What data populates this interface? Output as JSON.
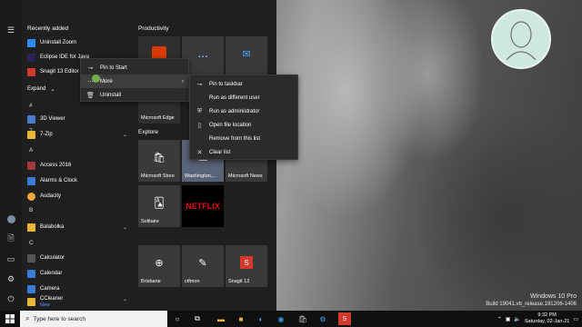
{
  "desktop": {
    "watermark_line1": "Windows 10 Pro",
    "watermark_line2": "Build 19041.vb_release.191206-1406"
  },
  "start": {
    "recently_added_label": "Recently added",
    "recent": [
      {
        "label": "Uninstall Zoom",
        "icon": "zoom-icon",
        "color": "#2d8cff"
      },
      {
        "label": "Eclipse IDE for Java",
        "icon": "eclipse-icon",
        "color": "#2c2255"
      },
      {
        "label": "Snagit 13 Editor",
        "icon": "snagit-icon",
        "color": "#d0392b"
      }
    ],
    "expand_label": "Expand",
    "sections": [
      {
        "letter": "#",
        "items": [
          {
            "label": "3D Viewer",
            "color": "#4a7cc9"
          }
        ]
      },
      {
        "letter": "7",
        "items": [
          {
            "label": "7-Zip",
            "color": "#e8b73a"
          }
        ]
      },
      {
        "letter": "A",
        "items": [
          {
            "label": "Access 2016",
            "color": "#a4373a"
          },
          {
            "label": "Alarms & Clock",
            "color": "#3a7bd5"
          },
          {
            "label": "Audacity",
            "color": "#f2a33c"
          }
        ]
      },
      {
        "letter": "B",
        "items": [
          {
            "label": "Balabolka",
            "color": "#e8b73a"
          }
        ]
      },
      {
        "letter": "C",
        "items": [
          {
            "label": "Calculator",
            "color": "#555555"
          },
          {
            "label": "Calendar",
            "color": "#3a7bd5"
          },
          {
            "label": "Camera",
            "color": "#3a7bd5"
          },
          {
            "label": "CCleaner",
            "color": "#e8b73a"
          }
        ]
      }
    ],
    "new_badge": "New",
    "productivity_label": "Productivity",
    "explore_label": "Explore",
    "tiles": {
      "edge": "Microsoft Edge",
      "store": "Microsoft Store",
      "weather": "Washington,...",
      "news": "Microsoft News",
      "solitaire": "Solitaire",
      "netflix": "NETFLIX",
      "brisbane": "Brisbane",
      "ctfmon": "ctfmon",
      "snagit": "Snagit 13"
    }
  },
  "context_menu": {
    "items": [
      "Pin to Start",
      "More",
      "Uninstall"
    ]
  },
  "more_menu": {
    "items": [
      "Pin to taskbar",
      "Run as different user",
      "Run as administrator",
      "Open file location",
      "Remove from this list",
      "Clear list"
    ]
  },
  "taskbar": {
    "search_placeholder": "Type here to search",
    "time": "9:32 PM",
    "date": "Saturday, 02-Jan-21"
  }
}
